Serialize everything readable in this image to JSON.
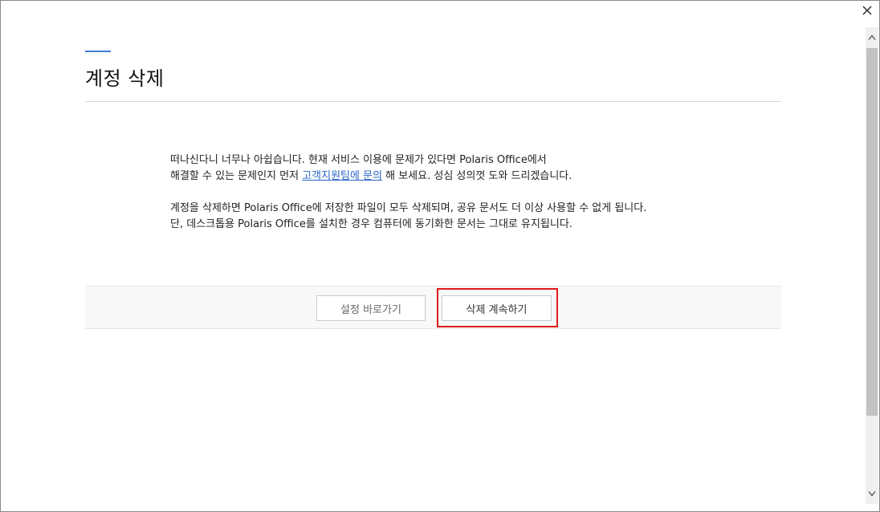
{
  "dialog": {
    "title": "계정 삭제",
    "close_icon": "close-icon"
  },
  "message": {
    "line1": "떠나신다니 너무나 아쉽습니다. 현재 서비스 이용에 문제가 있다면 Polaris Office에서",
    "line2_before": "해결할 수 있는 문제인지 먼저 ",
    "line2_link": "고객지원팀에 문의",
    "line2_after": " 해 보세요. 성심 성의껏 도와 드리겠습니다.",
    "line3": "계정을 삭제하면 Polaris Office에 저장한 파일이 모두 삭제되며, 공유 문서도 더 이상 사용할 수 없게 됩니다.",
    "line4": "단, 데스크톱용 Polaris Office를 설치한 경우 컴퓨터에 동기화한 문서는 그대로 유지됩니다."
  },
  "actions": {
    "settings_label": "설정 바로가기",
    "continue_label": "삭제 계속하기"
  },
  "colors": {
    "accent": "#3d7fd8",
    "link": "#2a66c8",
    "highlight": "#e01b1b"
  },
  "icons": {
    "scroll_up": "chevron-up-icon",
    "scroll_down": "chevron-down-icon"
  }
}
